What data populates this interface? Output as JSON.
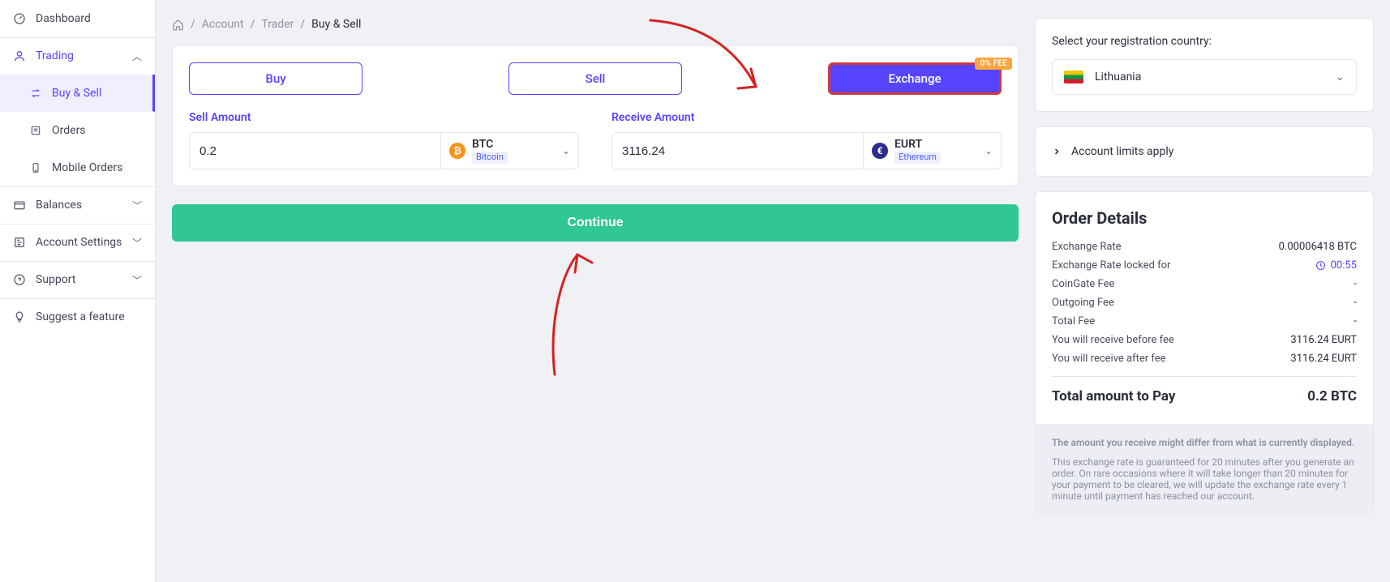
{
  "sidebar": {
    "items": [
      {
        "id": "dashboard",
        "label": "Dashboard"
      },
      {
        "id": "trading",
        "label": "Trading"
      },
      {
        "id": "buy-sell",
        "label": "Buy & Sell"
      },
      {
        "id": "orders",
        "label": "Orders"
      },
      {
        "id": "mobile-orders",
        "label": "Mobile Orders"
      },
      {
        "id": "balances",
        "label": "Balances"
      },
      {
        "id": "account-settings",
        "label": "Account Settings"
      },
      {
        "id": "support",
        "label": "Support"
      },
      {
        "id": "suggest",
        "label": "Suggest a feature"
      }
    ]
  },
  "breadcrumb": {
    "home_aria": "Home",
    "account": "Account",
    "trader": "Trader",
    "current": "Buy & Sell"
  },
  "tabs": {
    "buy": "Buy",
    "sell": "Sell",
    "exchange": "Exchange",
    "fee_badge": "0% FEE"
  },
  "sell": {
    "label": "Sell Amount",
    "value": "0.2",
    "currency_symbol": "BTC",
    "currency_network": "Bitcoin"
  },
  "receive": {
    "label": "Receive Amount",
    "value": "3116.24",
    "currency_symbol": "EURT",
    "currency_network": "Ethereum"
  },
  "continue_label": "Continue",
  "registration": {
    "title": "Select your registration country:",
    "country": "Lithuania"
  },
  "limits_label": "Account limits apply",
  "order": {
    "title": "Order Details",
    "exchange_rate_label": "Exchange Rate",
    "exchange_rate_value": "0.00006418 BTC",
    "rate_locked_label": "Exchange Rate locked for",
    "rate_locked_value": "00:55",
    "coingate_fee_label": "CoinGate Fee",
    "coingate_fee_value": "-",
    "outgoing_fee_label": "Outgoing Fee",
    "outgoing_fee_value": "-",
    "total_fee_label": "Total Fee",
    "total_fee_value": "-",
    "receive_before_label": "You will receive before fee",
    "receive_before_value": "3116.24 EURT",
    "receive_after_label": "You will receive after fee",
    "receive_after_value": "3116.24 EURT",
    "total_label": "Total amount to Pay",
    "total_value": "0.2 BTC",
    "disclaimer_bold": "The amount you receive might differ from what is currently displayed.",
    "disclaimer_text": "This exchange rate is guaranteed for 20 minutes after you generate an order. On rare occasions where it will take longer than 20 minutes for your payment to be cleared, we will update the exchange rate every 1 minute until payment has reached our account."
  }
}
